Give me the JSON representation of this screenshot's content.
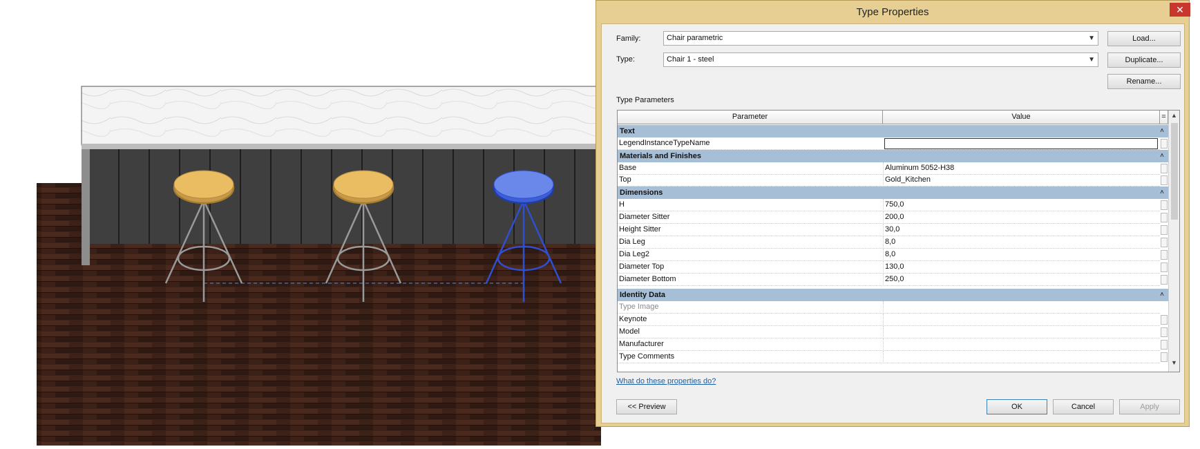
{
  "dialog": {
    "title": "Type Properties",
    "close_label": "✕",
    "family_label": "Family:",
    "family_value": "Chair parametric",
    "type_label": "Type:",
    "type_value": "Chair 1 - steel",
    "load_label": "Load...",
    "duplicate_label": "Duplicate...",
    "rename_label": "Rename...",
    "type_parameters_label": "Type Parameters",
    "columns": {
      "parameter": "Parameter",
      "value": "Value",
      "eq": "="
    },
    "help_link": "What do these properties do?",
    "preview_label": "<< Preview",
    "ok_label": "OK",
    "cancel_label": "Cancel",
    "apply_label": "Apply"
  },
  "groups": [
    {
      "name": "Text",
      "rows": [
        {
          "param": "LegendInstanceTypeName",
          "value": ""
        }
      ]
    },
    {
      "name": "Materials and Finishes",
      "rows": [
        {
          "param": "Base",
          "value": "Aluminum 5052-H38"
        },
        {
          "param": "Top",
          "value": "Gold_Kitchen"
        }
      ]
    },
    {
      "name": "Dimensions",
      "rows": [
        {
          "param": "H",
          "value": "750,0"
        },
        {
          "param": "Diameter Sitter",
          "value": "200,0"
        },
        {
          "param": "Height Sitter",
          "value": "30,0"
        },
        {
          "param": "Dia Leg",
          "value": "8,0"
        },
        {
          "param": "Dia Leg2",
          "value": "8,0"
        },
        {
          "param": "Diameter Top",
          "value": "130,0"
        },
        {
          "param": "Diameter Bottom",
          "value": "250,0"
        }
      ]
    },
    {
      "name": "Identity Data",
      "rows": [
        {
          "param": "Type Image",
          "value": ""
        },
        {
          "param": "Keynote",
          "value": ""
        },
        {
          "param": "Model",
          "value": ""
        },
        {
          "param": "Manufacturer",
          "value": ""
        },
        {
          "param": "Type Comments",
          "value": ""
        }
      ]
    }
  ],
  "colors": {
    "group_header": "#a7bfd6",
    "dialog_frame": "#e7cf94",
    "selected_chair": "#2f4fd0"
  }
}
